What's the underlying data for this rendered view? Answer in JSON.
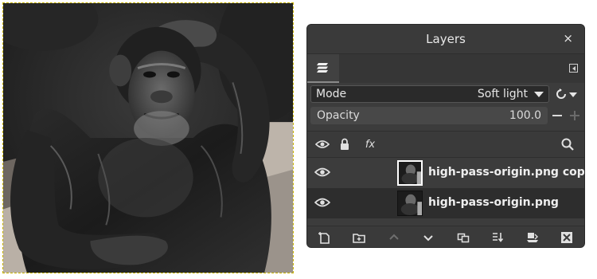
{
  "canvas": {
    "image": "chimpanzee photo",
    "selection_border_color": "#c9b400"
  },
  "dialog": {
    "title": "Layers",
    "close_symbol": "×",
    "tab_icon": "layers-stack-icon",
    "tab_menu_icon": "tab-menu-icon"
  },
  "mode": {
    "label": "Mode",
    "value": "Soft light",
    "switch_icon": "mode-switch-icon"
  },
  "opacity": {
    "label": "Opacity",
    "value": "100.0",
    "decrease_icon": "minus-icon",
    "increase_icon": "plus-icon"
  },
  "columns": {
    "visibility_icon": "eye-icon",
    "lock_icon": "lock-icon",
    "effects_icon": "fx-icon",
    "search_icon": "search-icon"
  },
  "layers": [
    {
      "name": "high-pass-origin.png copy",
      "visible": true,
      "selected": true
    },
    {
      "name": "high-pass-origin.png",
      "visible": true,
      "selected": false
    }
  ],
  "footer": {
    "icons": [
      "new-layer-icon",
      "new-group-icon",
      "raise-layer-icon",
      "lower-layer-icon",
      "duplicate-layer-icon",
      "merge-down-icon",
      "layer-mask-icon",
      "delete-layer-icon"
    ]
  },
  "colors": {
    "panel_bg": "#3c3c3c",
    "selected_row": "#3c3c3c",
    "row_bg": "#2d2d2d",
    "text": "#e2e2e2"
  }
}
